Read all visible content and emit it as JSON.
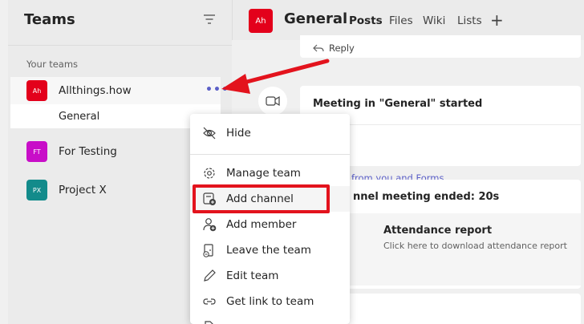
{
  "sidebar": {
    "title": "Teams",
    "section_label": "Your teams",
    "teams": [
      {
        "avatar": "Ah",
        "name": "Allthings.how",
        "color": "#e3001b",
        "more": "•••"
      },
      {
        "avatar": "FT",
        "name": "For Testing",
        "color": "#c80ec8"
      },
      {
        "avatar": "PX",
        "name": "Project X",
        "color": "#138b8b"
      }
    ],
    "channel": "General"
  },
  "header": {
    "avatar": "Ah",
    "title": "General",
    "tabs": [
      "Posts",
      "Files",
      "Wiki",
      "Lists"
    ],
    "plus": "+"
  },
  "feed": {
    "reply_label": "Reply",
    "meeting_started": "Meeting in \"General\" started",
    "meeting_link": "from you and Forms",
    "meeting_ended": "nnel meeting ended: 20s",
    "attendance_title": "Attendance report",
    "attendance_sub": "Click here to download attendance report"
  },
  "menu": {
    "items": [
      "Hide",
      "Manage team",
      "Add channel",
      "Add member",
      "Leave the team",
      "Edit team",
      "Get link to team"
    ]
  },
  "colors": {
    "accent": "#5b5fc7",
    "annotation": "#e3131d"
  }
}
